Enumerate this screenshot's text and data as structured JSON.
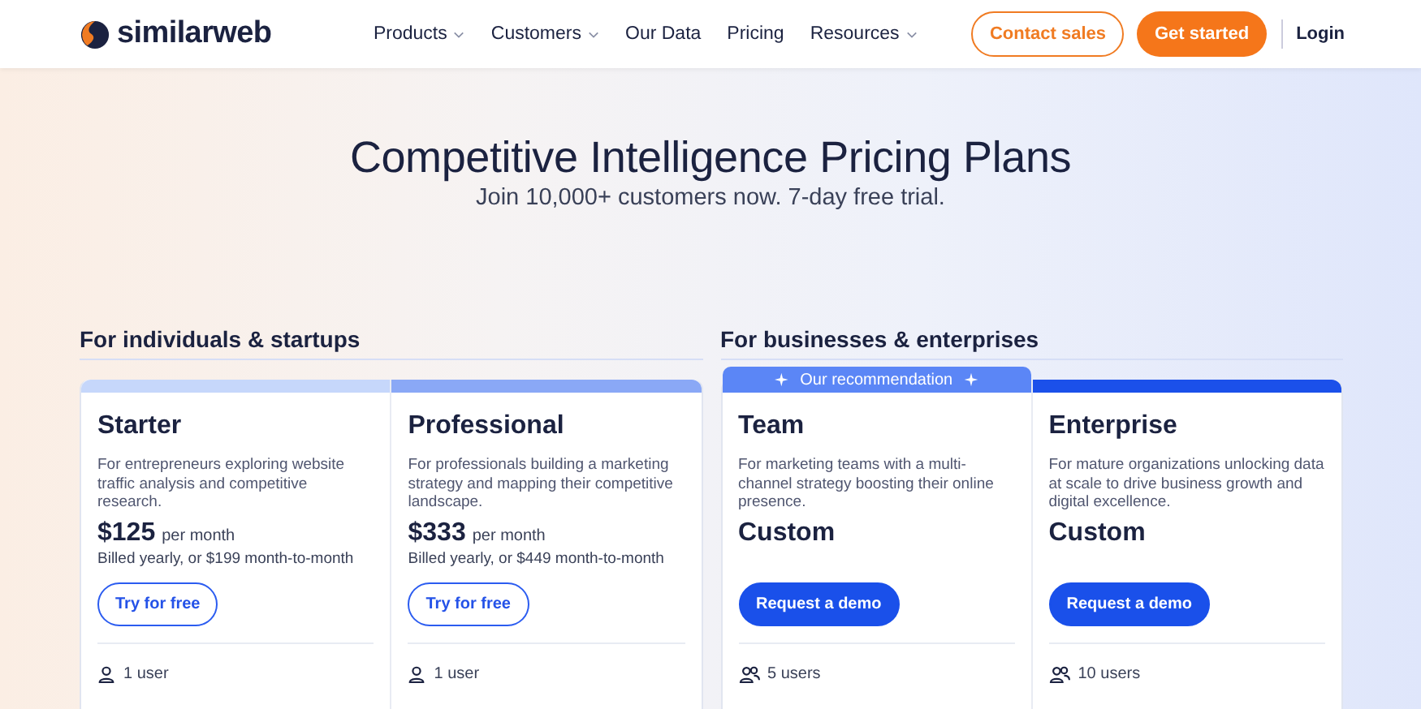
{
  "header": {
    "logo": "similarweb",
    "nav": [
      {
        "label": "Products",
        "has_menu": true
      },
      {
        "label": "Customers",
        "has_menu": true
      },
      {
        "label": "Our Data",
        "has_menu": false
      },
      {
        "label": "Pricing",
        "has_menu": false
      },
      {
        "label": "Resources",
        "has_menu": true
      }
    ],
    "contact_button": "Contact sales",
    "start_button": "Get started",
    "login": "Login"
  },
  "hero": {
    "title": "Competitive Intelligence Pricing Plans",
    "subtitle": "Join 10,000+ customers now. 7-day free trial."
  },
  "groups": [
    {
      "title": "For individuals & startups",
      "plans": [
        {
          "name": "Starter",
          "color": "#c6d7fb",
          "description": "For entrepreneurs exploring website traffic analysis and competitive research.",
          "price": "$125",
          "price_suffix": "per month",
          "billing": "Billed yearly, or $199 month-to-month",
          "button": {
            "label": "Try for free",
            "kind": "outline"
          },
          "users": {
            "kind": "single",
            "label": "1 user"
          }
        },
        {
          "name": "Professional",
          "color": "#8aa8f6",
          "description": "For professionals building a marketing strategy and mapping their competitive landscape.",
          "price": "$333",
          "price_suffix": "per month",
          "billing": "Billed yearly, or $449 month-to-month",
          "button": {
            "label": "Try for free",
            "kind": "outline"
          },
          "users": {
            "kind": "single",
            "label": "1 user"
          }
        }
      ]
    },
    {
      "title": "For businesses & enterprises",
      "plans": [
        {
          "name": "Team",
          "color": "#5b86f6",
          "badge": "Our recommendation",
          "description": "For marketing teams with a multi-channel strategy boosting their online presence.",
          "price": "Custom",
          "button": {
            "label": "Request a demo",
            "kind": "solid"
          },
          "users": {
            "kind": "group",
            "label": "5 users"
          }
        },
        {
          "name": "Enterprise",
          "color": "#1b50ea",
          "description": "For mature organizations unlocking data at scale to drive business growth and digital excellence.",
          "price": "Custom",
          "button": {
            "label": "Request a demo",
            "kind": "solid"
          },
          "users": {
            "kind": "group",
            "label": "10 users"
          }
        }
      ]
    }
  ]
}
